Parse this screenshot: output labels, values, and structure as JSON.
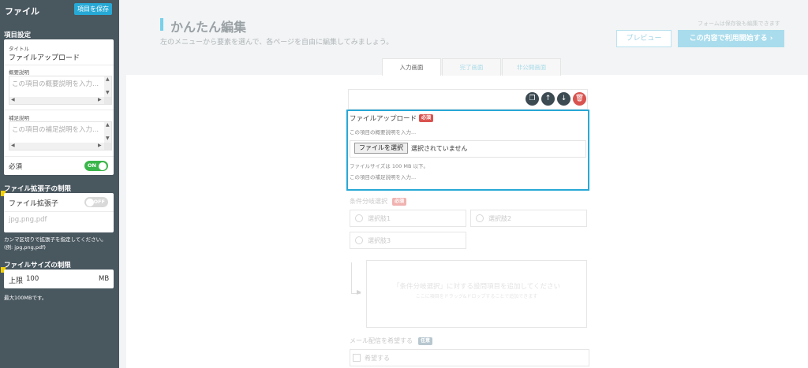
{
  "sidebar": {
    "title": "ファイル",
    "save_button": "項目を保存",
    "section_settings": "項目設定",
    "title_field": {
      "label": "タイトル",
      "value": "ファイルアップロード"
    },
    "summary_field": {
      "label": "概要説明",
      "placeholder": "この項目の概要説明を入力..."
    },
    "supplement_field": {
      "label": "補足説明",
      "placeholder": "この項目の補足説明を入力..."
    },
    "required": {
      "label": "必須",
      "toggle": "ON",
      "state": "on"
    },
    "section_ext": "ファイル拡張子の制限",
    "ext_field": {
      "label": "ファイル拡張子",
      "toggle": "OFF",
      "state": "off",
      "value": "jpg,png,pdf"
    },
    "ext_note_line1": "カンマ区切りで拡張子を指定してください。",
    "ext_note_line2": "(例: jpg,png,pdf)",
    "section_size": "ファイルサイズの制限",
    "size_field": {
      "label": "上限",
      "value": "100",
      "unit": "MB"
    },
    "size_note": "最大100MBです。"
  },
  "main": {
    "title": "かんたん編集",
    "subtitle": "左のメニューから要素を選んで、各ページを自由に編集してみましょう。",
    "top_note": "フォームは保存後も編集できます",
    "preview_button": "プレビュー",
    "start_button": "この内容で利用開始する ›",
    "tabs": [
      {
        "label": "入力画面",
        "active": true
      },
      {
        "label": "完了画面",
        "active": false
      },
      {
        "label": "非公開画面",
        "active": false
      }
    ]
  },
  "file_field": {
    "label": "ファイルアップロード",
    "badge": "必須",
    "summary_placeholder": "この項目の概要説明を入力...",
    "choose_button": "ファイルを選択",
    "no_file": "選択されていません",
    "size_note": "ファイルサイズは 100 MB 以下。",
    "supplement_placeholder": "この項目の補足説明を入力..."
  },
  "condition_field": {
    "label": "条件分岐選択",
    "badge": "必須",
    "options": [
      "選択肢1",
      "選択肢2",
      "選択肢3"
    ],
    "drop_main": "「条件分岐選択」に対する設問項目を追加してください",
    "drop_sub": "ここに項目をドラッグ&ドロップすることで追加できます"
  },
  "mail_field": {
    "label": "メール配信を希望する",
    "badge": "任意",
    "option": "希望する"
  },
  "icons": {
    "copy": "copy-icon",
    "up": "arrow-up-icon",
    "down": "arrow-down-icon",
    "delete": "trash-icon"
  },
  "colors": {
    "sidebar_bg": "#49575f",
    "accent": "#29a8d6",
    "toggle_on": "#3ab54a",
    "required": "#d9534f",
    "marker": "#f5d000"
  }
}
